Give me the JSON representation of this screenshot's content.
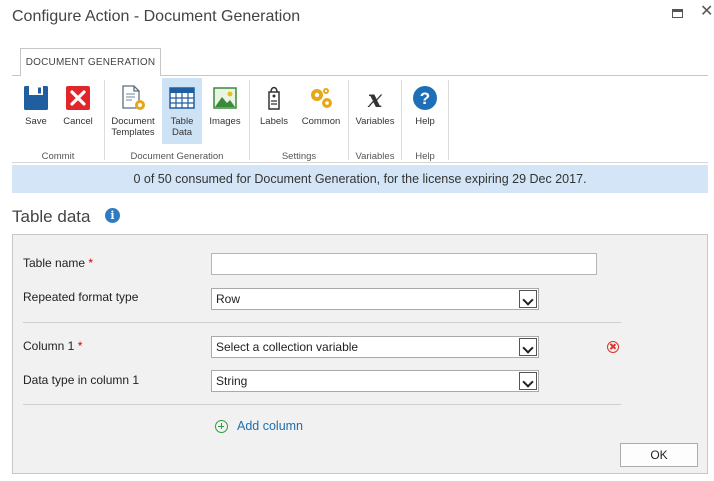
{
  "window": {
    "title": "Configure Action - Document Generation"
  },
  "ribbon": {
    "tab_label": "DOCUMENT GENERATION",
    "groups": {
      "commit": {
        "label": "Commit",
        "save": "Save",
        "cancel": "Cancel"
      },
      "docgen": {
        "label": "Document Generation",
        "templates_line1": "Document",
        "templates_line2": "Templates",
        "table_line1": "Table",
        "table_line2": "Data",
        "images": "Images"
      },
      "settings": {
        "label": "Settings",
        "labels": "Labels",
        "common": "Common"
      },
      "variables": {
        "label": "Variables",
        "variables": "Variables"
      },
      "help": {
        "label": "Help",
        "help": "Help"
      }
    }
  },
  "banner": {
    "text": "0 of 50 consumed for Document Generation, for the license expiring 29 Dec 2017."
  },
  "section": {
    "title": "Table data"
  },
  "form": {
    "required_mark": "*",
    "table_name_label": "Table name",
    "table_name_value": "",
    "repeated_format_label": "Repeated format type",
    "repeated_format_value": "Row",
    "column1_label": "Column 1",
    "column1_value": "Select a collection variable",
    "datatype_label": "Data type in column 1",
    "datatype_value": "String",
    "add_column": "Add column",
    "ok": "OK"
  },
  "colors": {
    "banner_bg": "#d3e5f6",
    "selected_button_bg": "#cde3f5",
    "accent_blue": "#1f6fae",
    "required_red": "#cc0000",
    "add_green": "#2e9e3e"
  }
}
